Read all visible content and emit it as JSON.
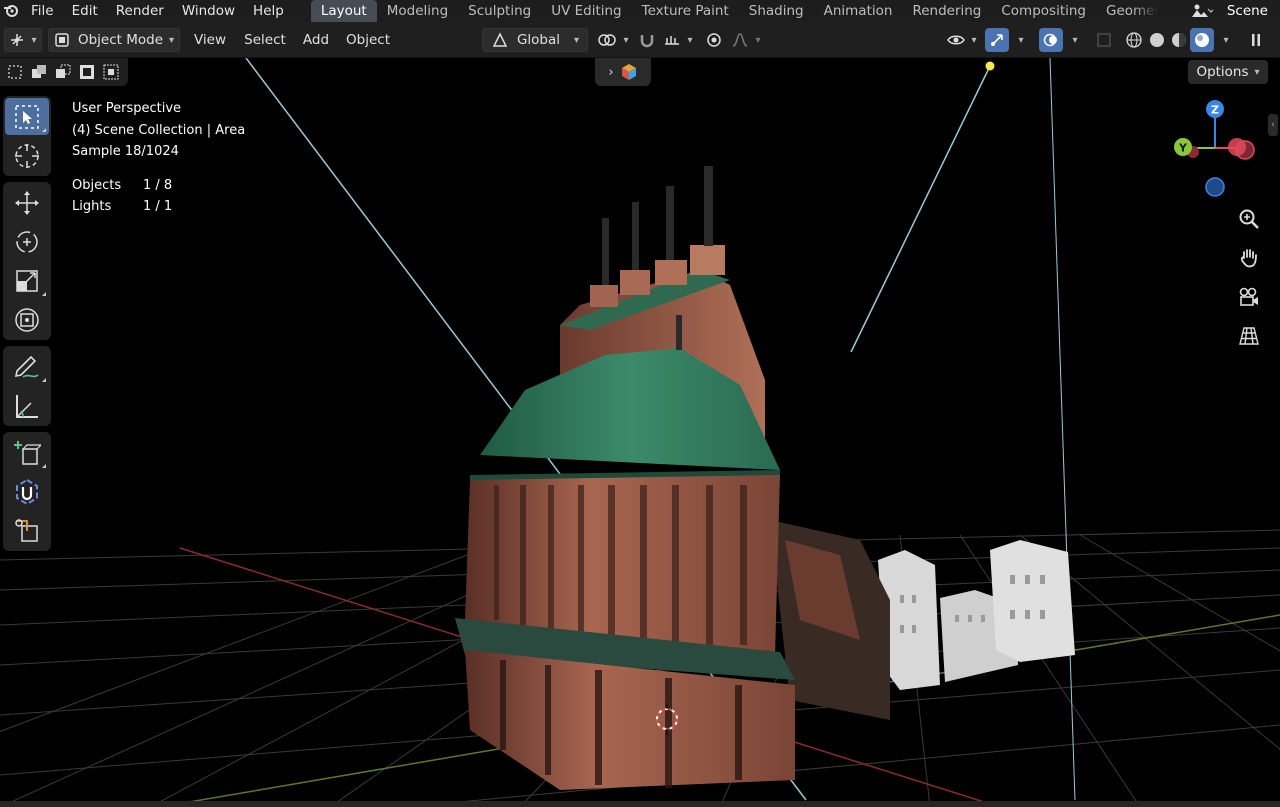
{
  "menu": {
    "items": [
      "File",
      "Edit",
      "Render",
      "Window",
      "Help"
    ]
  },
  "workspaces": {
    "tabs": [
      "Layout",
      "Modeling",
      "Sculpting",
      "UV Editing",
      "Texture Paint",
      "Shading",
      "Animation",
      "Rendering",
      "Compositing",
      "Geometr"
    ],
    "active": "Layout"
  },
  "scene": {
    "label": "Scene"
  },
  "viewport_header": {
    "mode_label": "Object Mode",
    "view_label": "View",
    "select_label": "Select",
    "add_label": "Add",
    "object_label": "Object",
    "transform_orientation": "Global"
  },
  "options": {
    "label": "Options"
  },
  "overlay": {
    "view_name": "User Perspective",
    "collection": "(4) Scene Collection | Area",
    "sample": "Sample 18/1024",
    "objects_label": "Objects",
    "objects_value": "1 / 8",
    "lights_label": "Lights",
    "lights_value": "1 / 1"
  },
  "gizmo": {
    "x": "X",
    "y": "Y",
    "z": "Z"
  },
  "colors": {
    "accent_blue": "#4a73b0",
    "gizmo_x": "#e64a5a",
    "gizmo_y": "#8ac73a",
    "gizmo_z": "#3a86e6",
    "roof_green": "#2f7a5a",
    "brick": "#9a5a48"
  }
}
